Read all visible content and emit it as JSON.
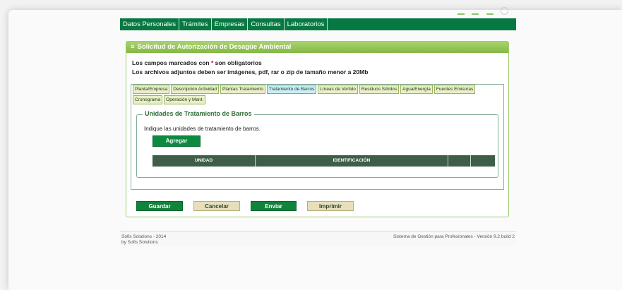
{
  "nav": {
    "items": [
      "Datos Personales",
      "Trámites",
      "Empresas",
      "Consultas",
      "Laboratorios"
    ]
  },
  "panel": {
    "title": "Solicitud de Autorización de Desagüe Ambiental",
    "bullet": "≡",
    "required_note_pre": "Los campos marcados con ",
    "required_mark": "*",
    "required_note_post": " son obligatorios",
    "attachments_note": "Los archivos adjuntos deben ser imágenes, pdf, rar o zip de tamaño menor a 20Mb"
  },
  "tabs": {
    "row1": [
      "Planta/Empresa",
      "Descripción Actividad",
      "Plantas Tratamiento",
      "Tratamiento de Barros",
      "Líneas de Vertido",
      "Residuos Sólidos",
      "Agua/Energía",
      "Fuentes Emisoras"
    ],
    "row2": [
      "Cronograma",
      "Operación y Mant."
    ],
    "active": "Tratamiento de Barros"
  },
  "section": {
    "legend": "Unidades de Tratamiento de Barros",
    "hint": "Indique las unidades de tratamiento de barros.",
    "add_label": "Agregar",
    "columns": [
      "UNIDAD",
      "IDENTIFICACIÓN",
      "",
      ""
    ]
  },
  "actions": {
    "save": "Guardar",
    "cancel": "Cancelar",
    "send": "Enviar",
    "print": "Imprimir"
  },
  "footer": {
    "line1": "Sofis Solutions - 2014",
    "line2": "by Sofis Solutions",
    "right": "Sistema de Gestión para Profesionales - Versión 9.2 build 2"
  },
  "colors": {
    "nav_bg": "#067841",
    "panel_header": "#8cc04f",
    "button_green": "#11843b",
    "button_beige": "#e7dfba",
    "active_tab": "#c8eef6"
  }
}
